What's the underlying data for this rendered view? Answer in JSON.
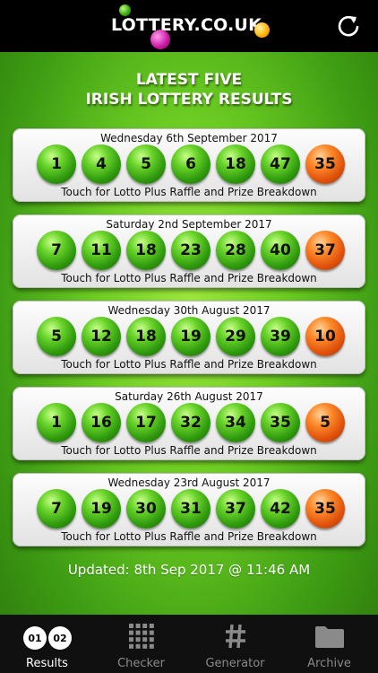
{
  "app": {
    "logo_text": "LOTTERY.CO.UK",
    "refresh_icon": "refresh-icon"
  },
  "heading": {
    "line1": "LATEST FIVE",
    "line2": "IRISH LOTTERY RESULTS"
  },
  "draws": [
    {
      "date": "Wednesday 6th September 2017",
      "numbers": [
        "1",
        "4",
        "5",
        "6",
        "18",
        "47"
      ],
      "bonus": "35",
      "action": "Touch for Lotto Plus Raffle and Prize Breakdown"
    },
    {
      "date": "Saturday 2nd September 2017",
      "numbers": [
        "7",
        "11",
        "18",
        "23",
        "28",
        "40"
      ],
      "bonus": "37",
      "action": "Touch for Lotto Plus Raffle and Prize Breakdown"
    },
    {
      "date": "Wednesday 30th August 2017",
      "numbers": [
        "5",
        "12",
        "18",
        "19",
        "29",
        "39"
      ],
      "bonus": "10",
      "action": "Touch for Lotto Plus Raffle and Prize Breakdown"
    },
    {
      "date": "Saturday 26th August 2017",
      "numbers": [
        "1",
        "16",
        "17",
        "32",
        "34",
        "35"
      ],
      "bonus": "5",
      "action": "Touch for Lotto Plus Raffle and Prize Breakdown"
    },
    {
      "date": "Wednesday 23rd August 2017",
      "numbers": [
        "7",
        "19",
        "30",
        "31",
        "37",
        "42"
      ],
      "bonus": "35",
      "action": "Touch for Lotto Plus Raffle and Prize Breakdown"
    }
  ],
  "updated": "Updated: 8th Sep 2017 @ 11:46 AM",
  "tabs": [
    {
      "label": "Results",
      "icon": "results-balls-icon",
      "pill1": "01",
      "pill2": "02",
      "active": true
    },
    {
      "label": "Checker",
      "icon": "grid-icon",
      "active": false
    },
    {
      "label": "Generator",
      "icon": "hash-icon",
      "active": false
    },
    {
      "label": "Archive",
      "icon": "folder-icon",
      "active": false
    }
  ],
  "colors": {
    "main_ball": "#2f9a0d",
    "bonus_ball": "#e0520c",
    "background": "#6ccc22",
    "tabbar": "#101010"
  }
}
